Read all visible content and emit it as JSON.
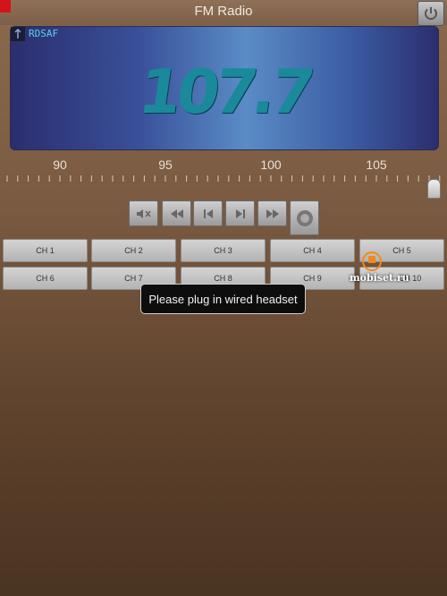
{
  "app": {
    "title": "FM Radio"
  },
  "display": {
    "rds": "RDSAF",
    "frequency": "107.7"
  },
  "tuner": {
    "scale_labels": [
      "90",
      "95",
      "100",
      "105"
    ],
    "position_mhz": 107.7
  },
  "controls": [
    {
      "name": "mute-button",
      "icon": "mute-icon"
    },
    {
      "name": "seek-back-button",
      "icon": "rewind-icon"
    },
    {
      "name": "previous-button",
      "icon": "skip-previous-icon"
    },
    {
      "name": "next-button",
      "icon": "skip-next-icon"
    },
    {
      "name": "seek-forward-button",
      "icon": "fast-forward-icon"
    },
    {
      "name": "record-button",
      "icon": "record-icon"
    }
  ],
  "channels": [
    "CH 1",
    "CH 2",
    "CH 3",
    "CH 4",
    "CH 5",
    "CH 6",
    "CH 7",
    "CH 8",
    "CH 9",
    "CH 10"
  ],
  "toast": "Please plug in wired headset",
  "watermark": "mobiset.ru",
  "colors": {
    "frequency": "#1a8a9a",
    "rds": "#5ad0e8",
    "alert_corner": "#d4141a"
  }
}
